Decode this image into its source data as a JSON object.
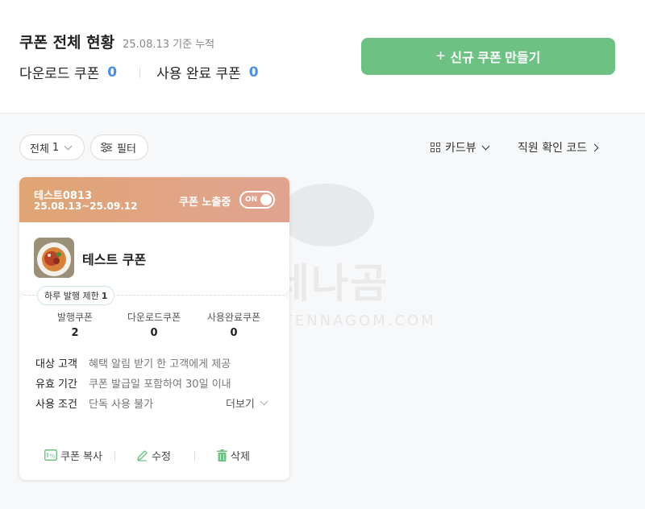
{
  "header": {
    "title": "쿠폰 전체 현황",
    "subtitle": "25.08.13 기준 누적",
    "download_label": "다운로드 쿠폰",
    "download_count": "0",
    "used_label": "사용 완료 쿠폰",
    "used_count": "0",
    "new_button_icon": "+",
    "new_button_label": "신규 쿠폰 만들기"
  },
  "toolbar": {
    "all_label": "전체",
    "all_count": "1",
    "filter_label": "필터",
    "view_label": "카드뷰",
    "staff_code_label": "직원 확인 코드"
  },
  "card": {
    "name": "테스트0813",
    "period": "25.08.13~25.09.12",
    "expose_label": "쿠폰 노출중",
    "toggle_state": "ON",
    "title": "테스트 쿠폰",
    "limit_label": "하루 발행 제한",
    "limit_value": "1",
    "stats": [
      {
        "label": "발행쿠폰",
        "value": "2"
      },
      {
        "label": "다운로드쿠폰",
        "value": "0"
      },
      {
        "label": "사용완료쿠폰",
        "value": "0"
      }
    ],
    "info": [
      {
        "key": "대상 고객",
        "value": "혜택 알림 받기 한 고객에게 제공"
      },
      {
        "key": "유효 기간",
        "value": "쿠폰 발급일 포함하여 30일 이내"
      },
      {
        "key": "사용 조건",
        "value": "단독 사용 불가"
      }
    ],
    "more_label": "더보기",
    "actions": {
      "copy": "쿠폰 복사",
      "edit": "수정",
      "delete": "삭제"
    }
  },
  "watermark": {
    "text": "안테나곰",
    "sub": "ANTENNAGOM.COM"
  },
  "colors": {
    "accent_green": "#6cc183",
    "count_blue": "#4a90e2",
    "card_head_start": "#dfa574",
    "card_head_end": "#e0a391"
  }
}
